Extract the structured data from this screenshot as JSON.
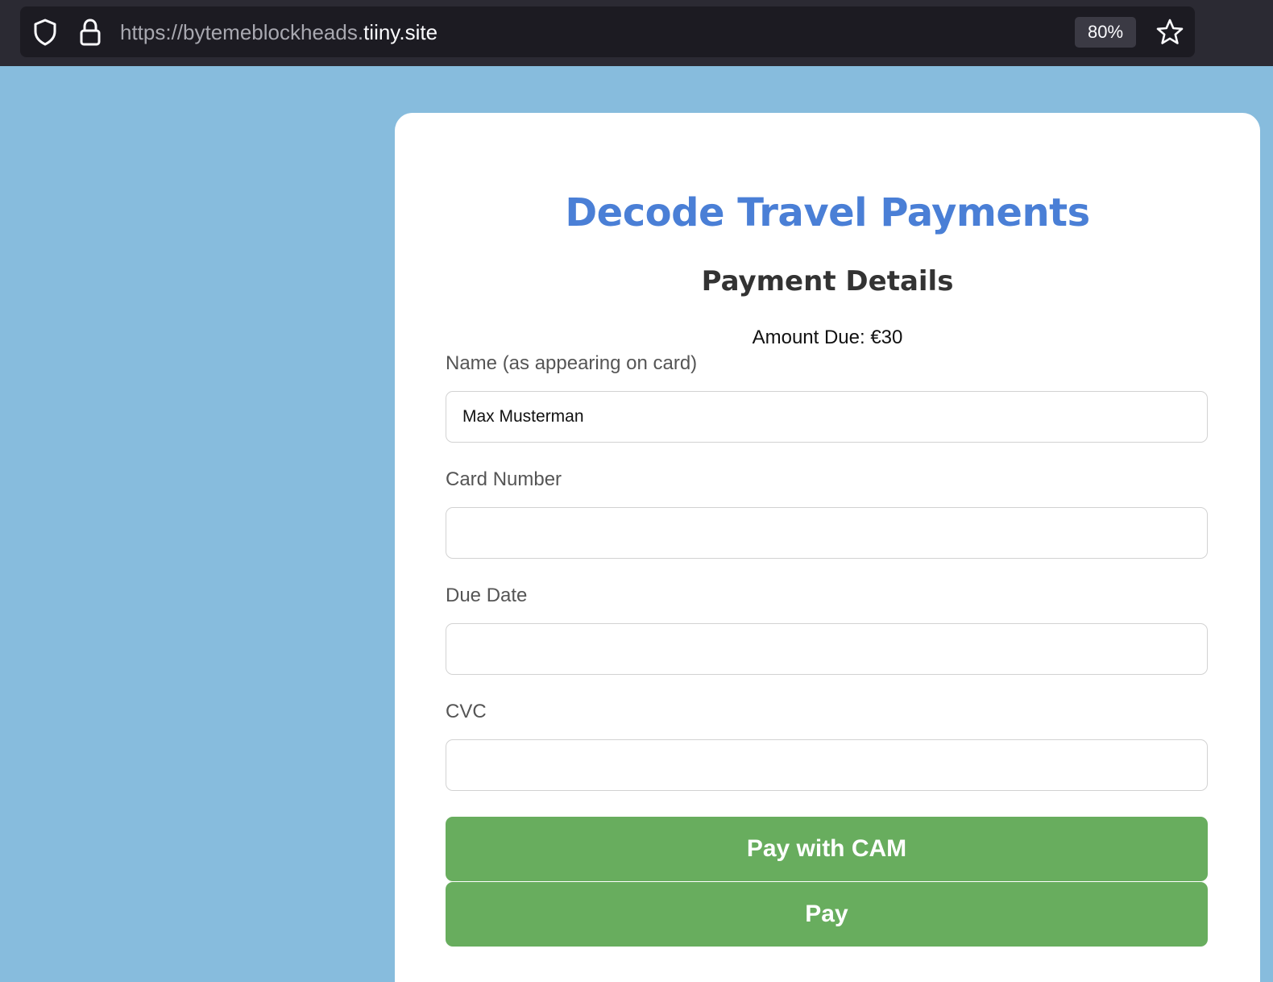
{
  "browser": {
    "url_prefix": "https://bytemeblockheads.",
    "url_host": "tiiny.site",
    "zoom": "80%",
    "icons": [
      "shield-icon",
      "lock-icon",
      "star-icon"
    ]
  },
  "page": {
    "title": "Decode Travel Payments",
    "subtitle": "Payment Details",
    "amount_due": "Amount Due: €30",
    "fields": {
      "name": {
        "label": "Name (as appearing on card)",
        "value": "Max Musterman",
        "placeholder": ""
      },
      "card_number": {
        "label": "Card Number",
        "value": "",
        "placeholder": ""
      },
      "due_date": {
        "label": "Due Date",
        "value": "",
        "placeholder": ""
      },
      "cvc": {
        "label": "CVC",
        "value": "",
        "placeholder": ""
      }
    },
    "buttons": {
      "pay_with_cam": "Pay with CAM",
      "pay": "Pay"
    }
  },
  "colors": {
    "page_background": "#87bcdd",
    "title": "#4a7fd6",
    "button": "#68ad5e",
    "browser_chrome": "#2b2a33"
  }
}
